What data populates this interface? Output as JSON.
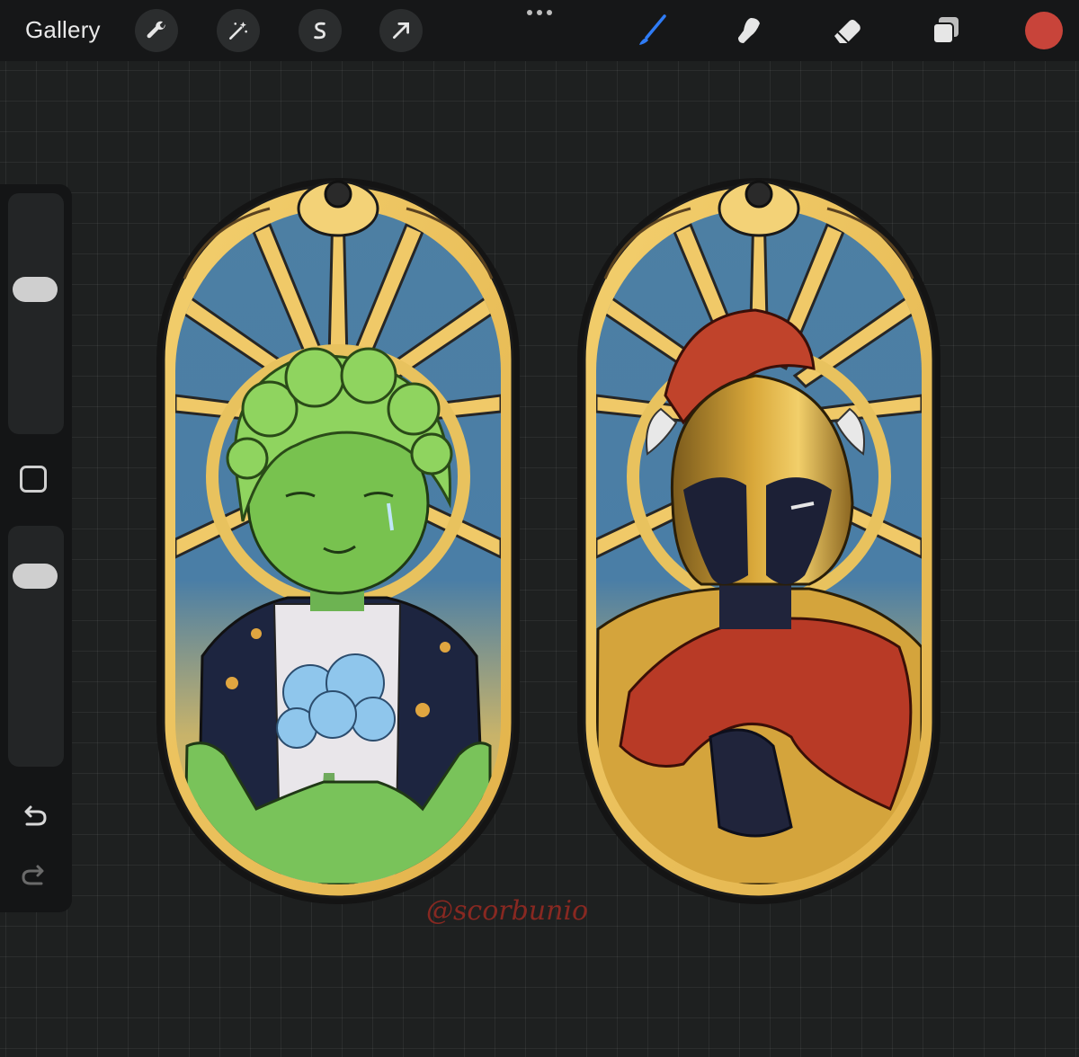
{
  "toolbar": {
    "gallery_label": "Gallery",
    "left_tools": [
      {
        "icon": "wrench-icon"
      },
      {
        "icon": "magic-wand-icon"
      },
      {
        "icon": "selection-icon"
      },
      {
        "icon": "transform-arrow-icon"
      }
    ],
    "right_tools": [
      {
        "icon": "brush-icon",
        "active": true
      },
      {
        "icon": "smudge-icon"
      },
      {
        "icon": "eraser-icon"
      },
      {
        "icon": "layers-icon"
      }
    ],
    "current_color": "#c8443a",
    "accent_color": "#2f7cf6"
  },
  "sidebar": {
    "brush_size_level": 0.62,
    "opacity_level": 0.85,
    "undo_icon": "undo-icon",
    "redo_icon": "redo-icon"
  },
  "artwork": {
    "watermark": "@scorbunio",
    "panels": [
      "green-haired-boy-portrait",
      "golden-helmet-knight-portrait"
    ]
  }
}
